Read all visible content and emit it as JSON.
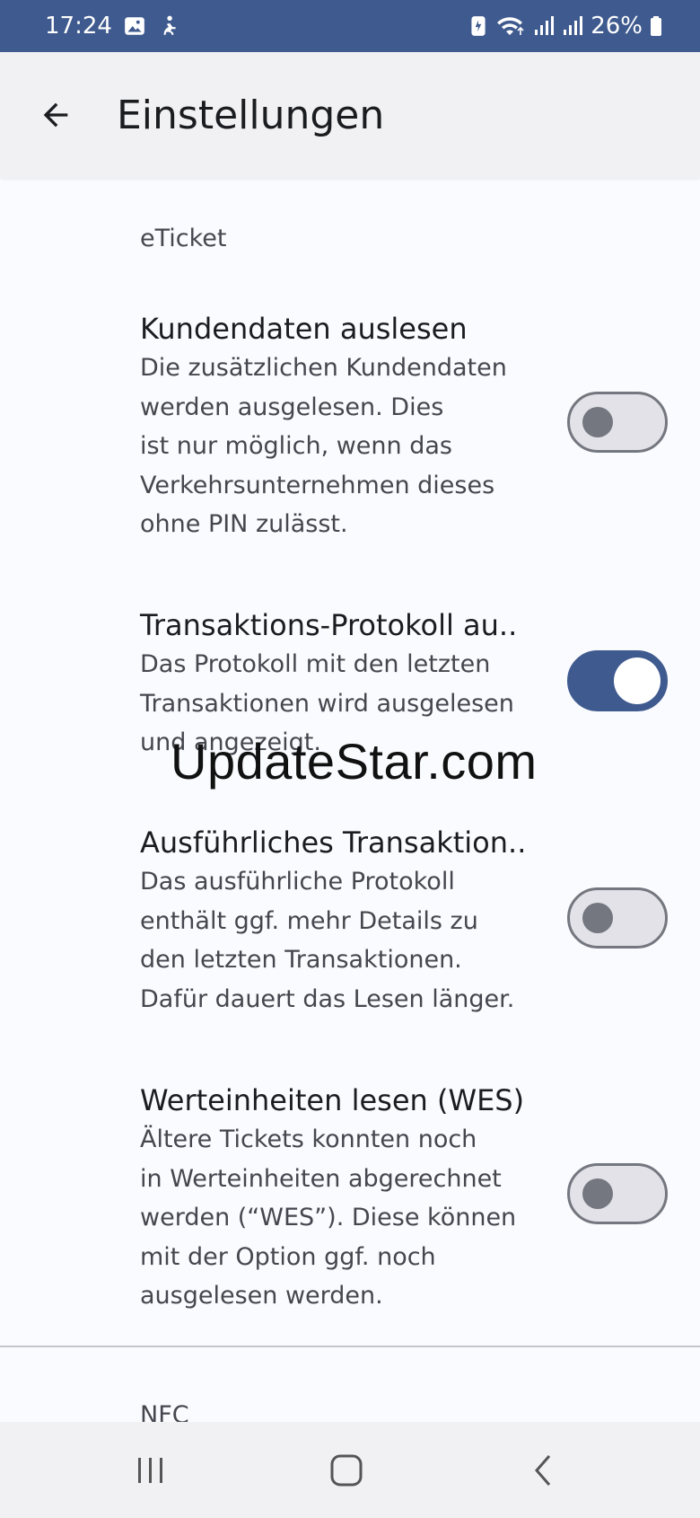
{
  "status_bar": {
    "time": "17:24",
    "battery_percent": "26%",
    "left_icons": [
      "gallery-icon",
      "accessibility-icon"
    ],
    "right_icons": [
      "battery-saver-icon",
      "wifi-icon",
      "signal-icon",
      "signal-icon",
      "battery-icon"
    ]
  },
  "app_bar": {
    "title": "Einstellungen",
    "back_icon": "arrow-back-icon"
  },
  "sections": {
    "eticket": {
      "header": "eTicket",
      "settings": [
        {
          "title": "Kundendaten auslesen",
          "description": "Die zusätzlichen Kundendaten\nwerden ausgelesen. Dies\nist nur möglich, wenn das\nVerkehrsunternehmen dieses\nohne PIN zulässt.",
          "enabled": false
        },
        {
          "title": "Transaktions-Protokoll au..",
          "description": "Das Protokoll mit den letzten\nTransaktionen wird ausgelesen\nund angezeigt.",
          "enabled": true
        },
        {
          "title": "Ausführliches Transaktion..",
          "description": "Das ausführliche Protokoll\nenthält ggf. mehr Details zu\nden letzten Transaktionen.\nDafür dauert das Lesen länger.",
          "enabled": false
        },
        {
          "title": "Werteinheiten lesen (WES)",
          "description": "Ältere Tickets konnten noch\nin Werteinheiten abgerechnet\nwerden (“WES”). Diese können\nmit der Option ggf. noch\nausgelesen werden.",
          "enabled": false
        }
      ]
    },
    "nfc": {
      "header": "NFC"
    }
  },
  "watermark": "UpdateStar.com",
  "nav_bar": {
    "icons": [
      "recent-apps-icon",
      "home-icon",
      "back-icon"
    ]
  },
  "colors": {
    "primary": "#3f5a8e",
    "toggle_off_track": "#e2e2e8",
    "toggle_off_outline": "#74777f",
    "background": "#fafbfe"
  }
}
